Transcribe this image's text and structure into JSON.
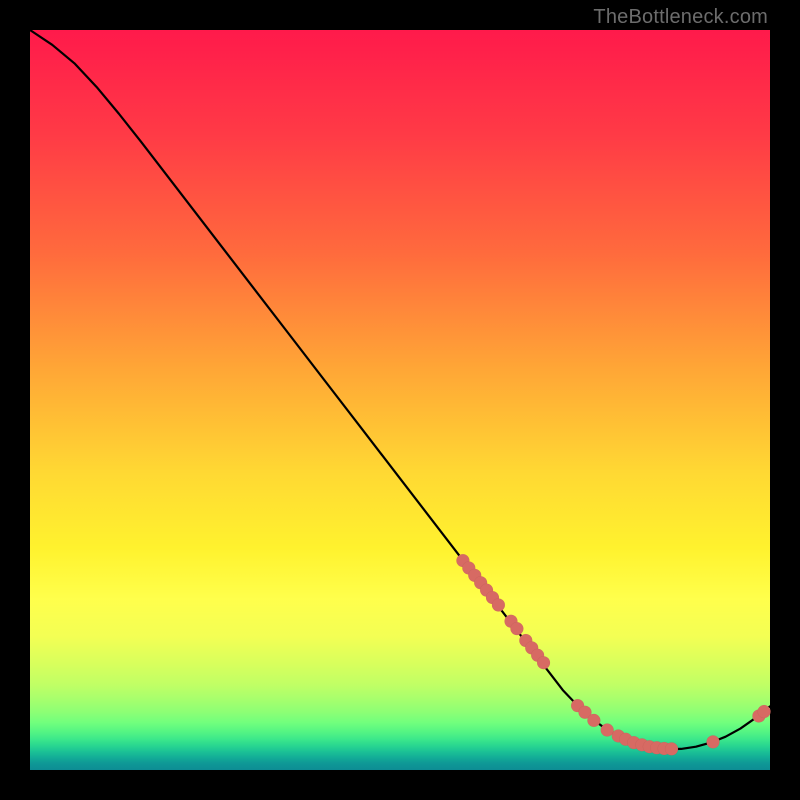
{
  "watermark": "TheBottleneck.com",
  "colors": {
    "marker": "#d76a63",
    "curve": "#000000"
  },
  "chart_data": {
    "type": "line",
    "title": "",
    "xlabel": "",
    "ylabel": "",
    "xlim": [
      0,
      100
    ],
    "ylim": [
      0,
      100
    ],
    "grid": false,
    "curve": [
      {
        "x": 0,
        "y": 100
      },
      {
        "x": 3,
        "y": 98
      },
      {
        "x": 6,
        "y": 95.5
      },
      {
        "x": 9,
        "y": 92.3
      },
      {
        "x": 12,
        "y": 88.7
      },
      {
        "x": 15,
        "y": 84.9
      },
      {
        "x": 18,
        "y": 81
      },
      {
        "x": 22,
        "y": 75.8
      },
      {
        "x": 26,
        "y": 70.6
      },
      {
        "x": 30,
        "y": 65.4
      },
      {
        "x": 35,
        "y": 58.9
      },
      {
        "x": 40,
        "y": 52.4
      },
      {
        "x": 45,
        "y": 45.9
      },
      {
        "x": 50,
        "y": 39.4
      },
      {
        "x": 55,
        "y": 32.9
      },
      {
        "x": 58,
        "y": 29
      },
      {
        "x": 62,
        "y": 23.8
      },
      {
        "x": 66,
        "y": 18.6
      },
      {
        "x": 70,
        "y": 13.4
      },
      {
        "x": 72,
        "y": 10.8
      },
      {
        "x": 74,
        "y": 8.7
      },
      {
        "x": 76,
        "y": 6.9
      },
      {
        "x": 78,
        "y": 5.4
      },
      {
        "x": 80,
        "y": 4.3
      },
      {
        "x": 82,
        "y": 3.5
      },
      {
        "x": 84,
        "y": 3
      },
      {
        "x": 86,
        "y": 2.8
      },
      {
        "x": 88,
        "y": 2.85
      },
      {
        "x": 90,
        "y": 3.15
      },
      {
        "x": 92,
        "y": 3.7
      },
      {
        "x": 94,
        "y": 4.5
      },
      {
        "x": 96,
        "y": 5.6
      },
      {
        "x": 98,
        "y": 7
      },
      {
        "x": 100,
        "y": 8.6
      }
    ],
    "markers": [
      {
        "x": 58.5,
        "y": 28.3
      },
      {
        "x": 59.3,
        "y": 27.3
      },
      {
        "x": 60.1,
        "y": 26.3
      },
      {
        "x": 60.9,
        "y": 25.3
      },
      {
        "x": 61.7,
        "y": 24.3
      },
      {
        "x": 62.5,
        "y": 23.3
      },
      {
        "x": 63.3,
        "y": 22.3
      },
      {
        "x": 65.0,
        "y": 20.1
      },
      {
        "x": 65.8,
        "y": 19.1
      },
      {
        "x": 67.0,
        "y": 17.5
      },
      {
        "x": 67.8,
        "y": 16.5
      },
      {
        "x": 68.6,
        "y": 15.5
      },
      {
        "x": 69.4,
        "y": 14.5
      },
      {
        "x": 74.0,
        "y": 8.7
      },
      {
        "x": 75.0,
        "y": 7.8
      },
      {
        "x": 76.2,
        "y": 6.7
      },
      {
        "x": 78.0,
        "y": 5.4
      },
      {
        "x": 79.5,
        "y": 4.6
      },
      {
        "x": 80.5,
        "y": 4.15
      },
      {
        "x": 81.6,
        "y": 3.7
      },
      {
        "x": 82.7,
        "y": 3.4
      },
      {
        "x": 83.7,
        "y": 3.15
      },
      {
        "x": 84.7,
        "y": 3.0
      },
      {
        "x": 85.7,
        "y": 2.9
      },
      {
        "x": 86.7,
        "y": 2.85
      },
      {
        "x": 92.3,
        "y": 3.8
      },
      {
        "x": 98.5,
        "y": 7.3
      },
      {
        "x": 99.2,
        "y": 7.9
      }
    ]
  }
}
